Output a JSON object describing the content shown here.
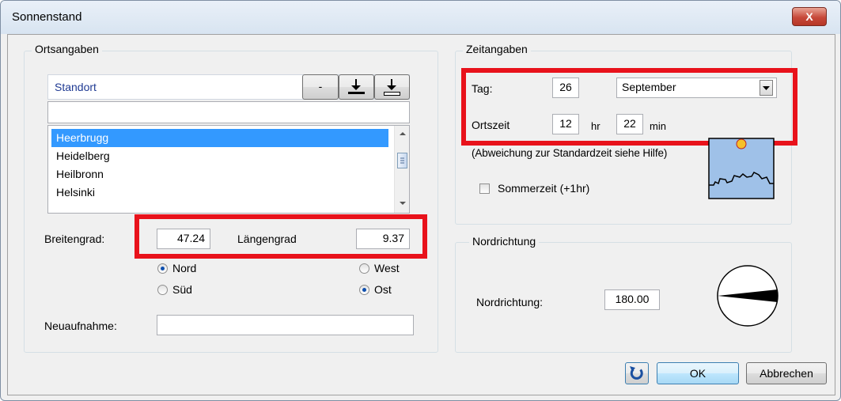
{
  "window": {
    "title": "Sonnenstand",
    "close_label": "X"
  },
  "ortsangaben": {
    "legend": "Ortsangaben",
    "standort_label": "Standort",
    "header_buttons": [
      "-",
      "⭳",
      "⭳"
    ],
    "search_value": "",
    "list_items": [
      "Heerbrugg",
      "Heidelberg",
      "Heilbronn",
      "Helsinki"
    ],
    "selected_item": "Heerbrugg",
    "breitengrad_label": "Breitengrad:",
    "breitengrad_value": "47.24",
    "laengengrad_label": "Längengrad",
    "laengengrad_value": "9.37",
    "nord_label": "Nord",
    "sued_label": "Süd",
    "west_label": "West",
    "ost_label": "Ost",
    "neuaufnahme_label": "Neuaufnahme:",
    "neuaufnahme_value": ""
  },
  "zeitangaben": {
    "legend": "Zeitangaben",
    "tag_label": "Tag:",
    "tag_value": "26",
    "month_value": "September",
    "ortszeit_label": "Ortszeit",
    "hour_value": "12",
    "hour_unit": "hr",
    "minute_value": "22",
    "minute_unit": "min",
    "hint": "(Abweichung zur Standardzeit siehe Hilfe)",
    "sommerzeit_label": "Sommerzeit (+1hr)",
    "sommerzeit_checked": false
  },
  "nordrichtung": {
    "legend": "Nordrichtung",
    "label": "Nordrichtung:",
    "value": "180.00"
  },
  "footer": {
    "ok_label": "OK",
    "cancel_label": "Abbrechen"
  },
  "colors": {
    "highlight": "#e8121b",
    "selection": "#3399ff",
    "sky": "#9fc1e8",
    "sun": "#f5c12a"
  },
  "radio_state": {
    "nord": true,
    "sued": false,
    "west": false,
    "ost": true
  }
}
